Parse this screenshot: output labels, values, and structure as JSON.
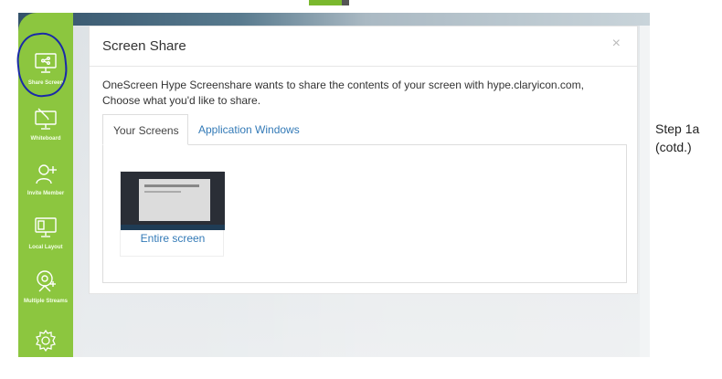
{
  "sidebar": {
    "items": [
      {
        "label": "Share Screen",
        "icon": "share-screen-icon"
      },
      {
        "label": "Whiteboard",
        "icon": "whiteboard-icon"
      },
      {
        "label": "Invite Member",
        "icon": "invite-member-icon"
      },
      {
        "label": "Local Layout",
        "icon": "local-layout-icon"
      },
      {
        "label": "Multiple Streams",
        "icon": "webcam-icon"
      },
      {
        "label": "",
        "icon": "gear-icon"
      }
    ]
  },
  "modal": {
    "title": "Screen Share",
    "close": "×",
    "description": "OneScreen Hype Screenshare wants to share the contents of your screen with hype.claryicon.com, Choose what you'd like to share.",
    "tabs": [
      {
        "label": "Your Screens",
        "active": true
      },
      {
        "label": "Application Windows",
        "active": false
      }
    ],
    "screens": [
      {
        "label": "Entire screen"
      }
    ]
  },
  "annotation": {
    "line1": "Step 1a",
    "line2": "(cotd.)"
  },
  "colors": {
    "sidebar": "#8cc63f",
    "link": "#337ab7",
    "highlight": "#1a2aa8"
  }
}
